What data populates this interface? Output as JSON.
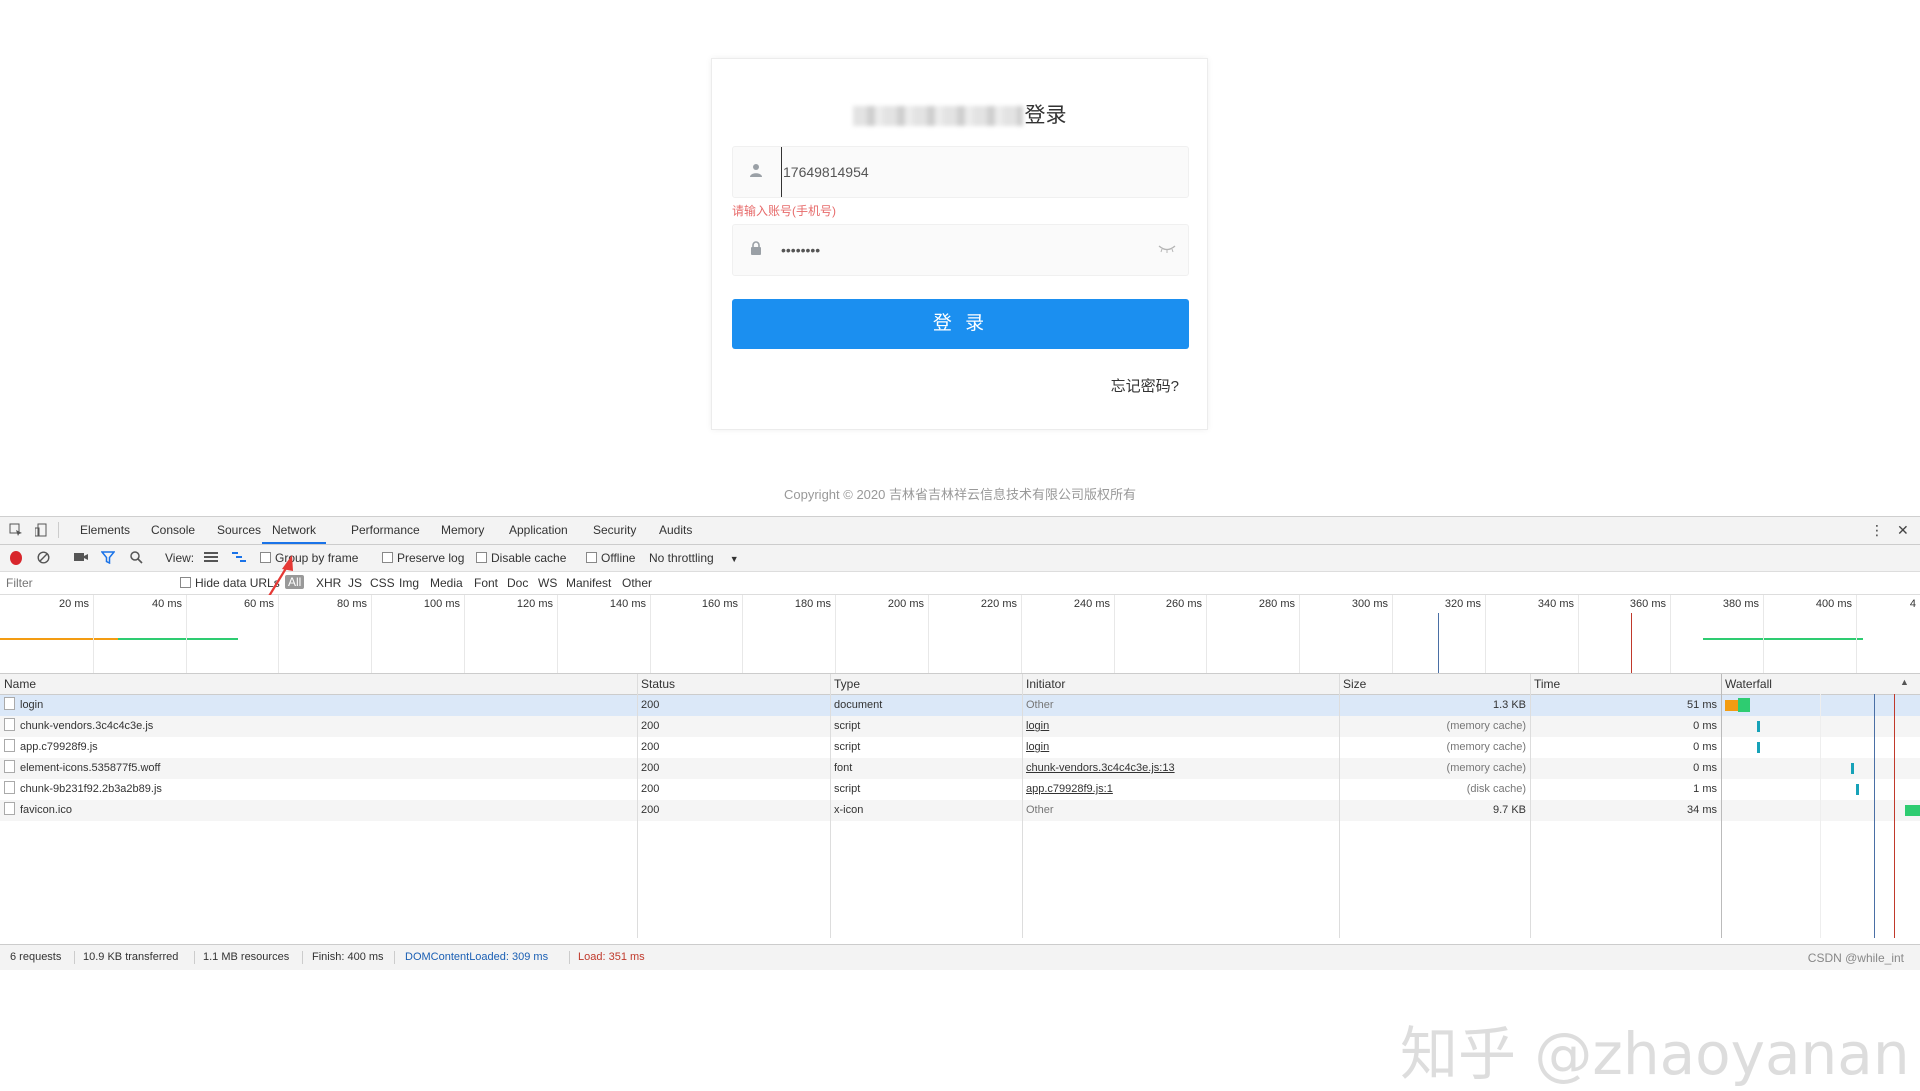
{
  "login": {
    "title_suffix": "登录",
    "username_value": "17649814954",
    "error_text": "请输入账号(手机号)",
    "password_value": "••••••••",
    "login_button": "登 录",
    "forgot": "忘记密码?",
    "copyright": "Copyright © 2020 吉林省吉林祥云信息技术有限公司版权所有"
  },
  "devtools": {
    "tabs": [
      "Elements",
      "Console",
      "Sources",
      "Network",
      "Performance",
      "Memory",
      "Application",
      "Security",
      "Audits"
    ],
    "active_tab": "Network",
    "toolbar": {
      "view_label": "View:",
      "group_by_frame": "Group by frame",
      "preserve_log": "Preserve log",
      "disable_cache": "Disable cache",
      "offline": "Offline",
      "throttling": "No throttling"
    },
    "filter": {
      "placeholder": "Filter",
      "hide_data_urls": "Hide data URLs",
      "types": [
        "All",
        "XHR",
        "JS",
        "CSS",
        "Img",
        "Media",
        "Font",
        "Doc",
        "WS",
        "Manifest",
        "Other"
      ]
    },
    "overview_ticks": [
      "20 ms",
      "40 ms",
      "60 ms",
      "80 ms",
      "100 ms",
      "120 ms",
      "140 ms",
      "160 ms",
      "180 ms",
      "200 ms",
      "220 ms",
      "240 ms",
      "260 ms",
      "280 ms",
      "300 ms",
      "320 ms",
      "340 ms",
      "360 ms",
      "380 ms",
      "400 ms",
      "4"
    ],
    "columns": [
      "Name",
      "Status",
      "Type",
      "Initiator",
      "Size",
      "Time",
      "Waterfall"
    ],
    "rows": [
      {
        "name": "login",
        "status": "200",
        "type": "document",
        "initiator": "Other",
        "size": "1.3 KB",
        "time": "51 ms"
      },
      {
        "name": "chunk-vendors.3c4c4c3e.js",
        "status": "200",
        "type": "script",
        "initiator": "login",
        "size": "(memory cache)",
        "time": "0 ms"
      },
      {
        "name": "app.c79928f9.js",
        "status": "200",
        "type": "script",
        "initiator": "login",
        "size": "(memory cache)",
        "time": "0 ms"
      },
      {
        "name": "element-icons.535877f5.woff",
        "status": "200",
        "type": "font",
        "initiator": "chunk-vendors.3c4c4c3e.js:13",
        "size": "(memory cache)",
        "time": "0 ms"
      },
      {
        "name": "chunk-9b231f92.2b3a2b89.js",
        "status": "200",
        "type": "script",
        "initiator": "app.c79928f9.js:1",
        "size": "(disk cache)",
        "time": "1 ms"
      },
      {
        "name": "favicon.ico",
        "status": "200",
        "type": "x-icon",
        "initiator": "Other",
        "size": "9.7 KB",
        "time": "34 ms"
      }
    ],
    "status_bar": {
      "requests": "6 requests",
      "transferred": "10.9 KB transferred",
      "resources": "1.1 MB resources",
      "finish": "Finish: 400 ms",
      "dom_loaded": "DOMContentLoaded: 309 ms",
      "load": "Load: 351 ms"
    }
  },
  "watermark": "知乎 @zhaoyanan",
  "csdn_mark": "CSDN @while_int",
  "colors": {
    "accent": "#1b8ff0",
    "error": "#e76b6b",
    "devtools_blue": "#1a73e8",
    "load_red": "#c0392b"
  }
}
